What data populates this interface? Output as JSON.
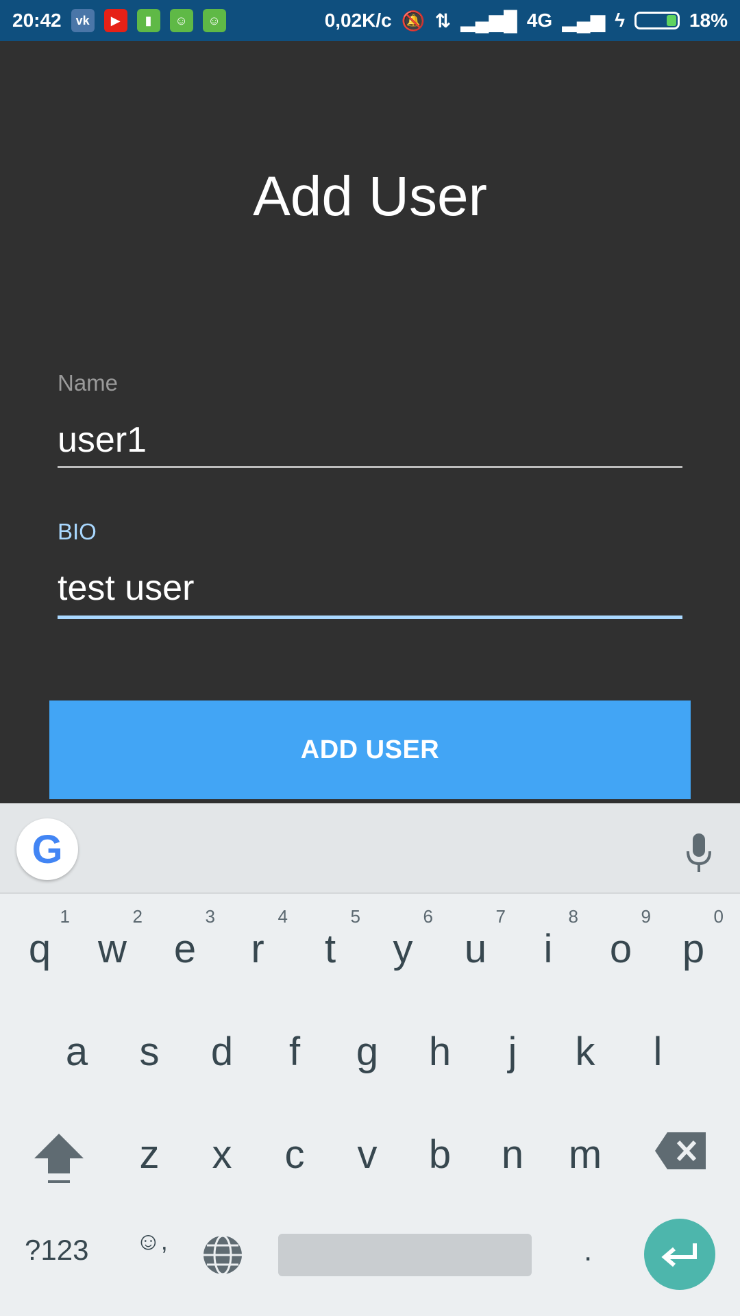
{
  "status_bar": {
    "time": "20:42",
    "net_speed": "0,02K/c",
    "network_type": "4G",
    "battery_percent": "18%",
    "battery_level": 0.18,
    "notification_icons": [
      "vk-icon",
      "youtube-icon",
      "battery-saver-icon",
      "android-icon",
      "android-icon"
    ]
  },
  "screen": {
    "title": "Add User",
    "fields": {
      "name": {
        "label": "Name",
        "value": "user1"
      },
      "bio": {
        "label": "BIO",
        "value": "test user"
      }
    },
    "submit_label": "ADD USER"
  },
  "keyboard": {
    "row1": [
      {
        "key": "q",
        "hint": "1"
      },
      {
        "key": "w",
        "hint": "2"
      },
      {
        "key": "e",
        "hint": "3"
      },
      {
        "key": "r",
        "hint": "4"
      },
      {
        "key": "t",
        "hint": "5"
      },
      {
        "key": "y",
        "hint": "6"
      },
      {
        "key": "u",
        "hint": "7"
      },
      {
        "key": "i",
        "hint": "8"
      },
      {
        "key": "o",
        "hint": "9"
      },
      {
        "key": "p",
        "hint": "0"
      }
    ],
    "row2": [
      "a",
      "s",
      "d",
      "f",
      "g",
      "h",
      "j",
      "k",
      "l"
    ],
    "row3": [
      "z",
      "x",
      "c",
      "v",
      "b",
      "n",
      "m"
    ],
    "symbols_label": "?123",
    "emoji_label": "☺,",
    "period_label": ".",
    "google_label": "G"
  },
  "colors": {
    "background": "#303030",
    "status_bar": "#0f4f7e",
    "button": "#42a5f5",
    "focus_accent": "#a9d8ff",
    "enter_key": "#4db6ac"
  }
}
